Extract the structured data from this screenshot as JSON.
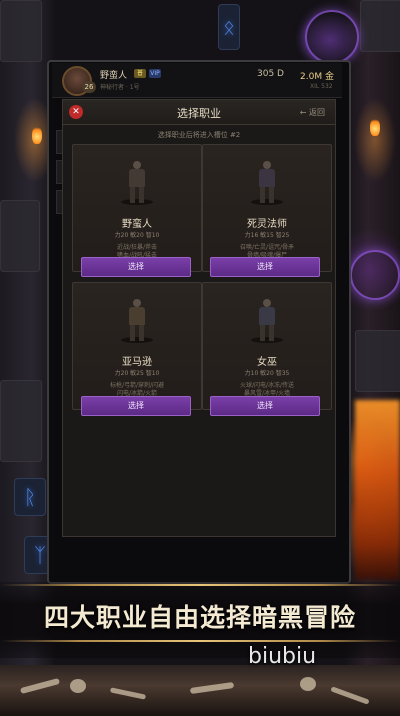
{
  "hud": {
    "player_name": "野蛮人",
    "level": "26",
    "tag_a": "普",
    "tag_b": "VIP",
    "subtitle": "神秘行者 · 1号",
    "resource_1": "305 D",
    "resource_2": "2.0M 金",
    "resource_3": "XIL 532"
  },
  "modal": {
    "title": "选择职业",
    "close_label": "✕",
    "back_label": "← 返回",
    "hint": "选择职业后将进入槽位 #2"
  },
  "classes": [
    {
      "name": "野蛮人",
      "stats": "力20 敏20 智10",
      "desc": "近战/狂暴/斧击\n嗜血/战吼/猛击",
      "button": "选择"
    },
    {
      "name": "死灵法师",
      "stats": "力16 敏15 智25",
      "desc": "召唤/亡灵/诅咒/骨矛\n骨墙/吸魂/爆尸",
      "button": "选择"
    },
    {
      "name": "亚马逊",
      "stats": "力20 敏25 智10",
      "desc": "标枪/弓箭/穿刺/闪避\n闪电/冰箭/火箭",
      "button": "选择"
    },
    {
      "name": "女巫",
      "stats": "力10 敏20 智35",
      "desc": "火球/闪电/冰冻/传送\n暴风雪/冰甲/火墙",
      "button": "选择"
    }
  ],
  "banner": {
    "slogan": "四大职业自由选择暗黑冒险",
    "brand": "biubiu"
  },
  "colors": {
    "accent_purple": "#6d33a0",
    "gold": "#e8cf8a",
    "close_red": "#c02a2a"
  }
}
